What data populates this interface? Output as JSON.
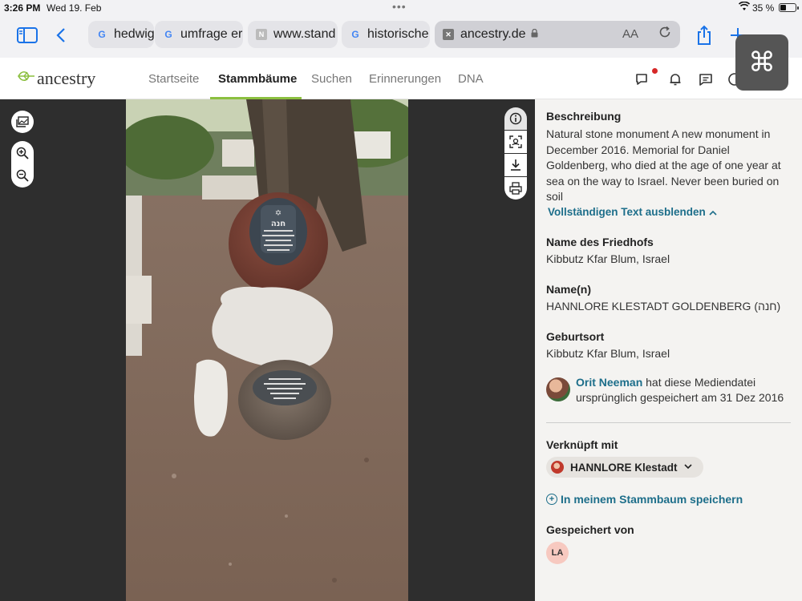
{
  "status_bar": {
    "time": "3:26 PM",
    "date": "Wed 19. Feb",
    "battery": "35 %"
  },
  "browser": {
    "tabs": [
      {
        "label": "hedwig",
        "favicon": "G"
      },
      {
        "label": "umfrage er",
        "favicon": "G"
      },
      {
        "label": "www.stand",
        "favicon": "N"
      },
      {
        "label": "historische",
        "favicon": "G"
      }
    ],
    "active_tab": {
      "label": "ancestry.de",
      "favicon": "✕",
      "text_size": "AA"
    },
    "cmd_glyph": "⌘"
  },
  "site": {
    "logo": "ancestry",
    "nav": [
      "Startseite",
      "Stammbäume",
      "Suchen",
      "Erinnerungen",
      "DNA"
    ],
    "accent": "#8bbf3f",
    "link_color": "#1d6e8a"
  },
  "details": {
    "description_label": "Beschreibung",
    "description_text": "Natural stone monument  A new monument in December 2016. Memorial for Daniel Goldenberg, who died at the age of one year at sea on the way to Israel.  Never been buried on soil",
    "toggle_text": "Vollständigen Text ausblenden",
    "cemetery_label": "Name des Friedhofs",
    "cemetery_value": "Kibbutz Kfar Blum, Israel",
    "names_label": "Name(n)",
    "names_value": "HANNLORE KLESTADT GOLDENBERG (חנה)",
    "birthplace_label": "Geburtsort",
    "birthplace_value": "Kibbutz Kfar Blum, Israel",
    "uploader_name": "Orit Neeman",
    "uploader_text": " hat diese Mediendatei ursprünglich gespeichert am 31 Dez 2016",
    "linked_label": "Verknüpft mit",
    "linked_person": "HANNLORE Klestadt",
    "save_link": "In meinem Stammbaum speichern",
    "saved_by_label": "Gespeichert von",
    "saved_by_initials": "LA"
  }
}
